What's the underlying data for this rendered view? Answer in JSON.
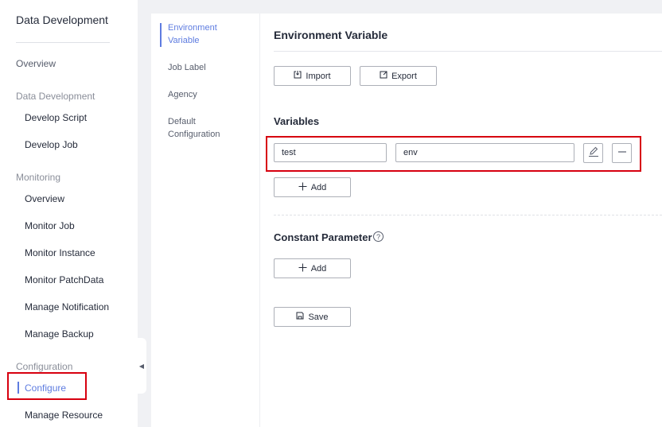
{
  "sidebar": {
    "title": "Data Development",
    "overview": "Overview",
    "groups": {
      "data_development": "Data Development",
      "monitoring": "Monitoring",
      "configuration": "Configuration"
    },
    "items": {
      "develop_script": "Develop Script",
      "develop_job": "Develop Job",
      "monitor_overview": "Overview",
      "monitor_job": "Monitor Job",
      "monitor_instance": "Monitor Instance",
      "monitor_patchdata": "Monitor PatchData",
      "manage_notification": "Manage Notification",
      "manage_backup": "Manage Backup",
      "configure": "Configure",
      "manage_resource": "Manage Resource"
    },
    "active_item": "Configure"
  },
  "subnav": {
    "items": [
      {
        "label": "Environment Variable",
        "active": true
      },
      {
        "label": "Job Label",
        "active": false
      },
      {
        "label": "Agency",
        "active": false
      },
      {
        "label": "Default Configuration",
        "active": false
      }
    ]
  },
  "main": {
    "title": "Environment Variable",
    "import_label": "Import",
    "export_label": "Export",
    "variables_label": "Variables",
    "variable_row": {
      "name": "test",
      "value": "env"
    },
    "add_label": "Add",
    "constant_label": "Constant Parameter",
    "help_glyph": "?",
    "save_label": "Save"
  },
  "colors": {
    "accent": "#5e7ce0",
    "highlight": "#d7000f",
    "border": "#adb0b8"
  },
  "icons": [
    "import-icon",
    "export-icon",
    "edit-icon",
    "minus-icon",
    "plus-icon",
    "save-icon",
    "help-icon",
    "collapse-arrow-icon"
  ]
}
